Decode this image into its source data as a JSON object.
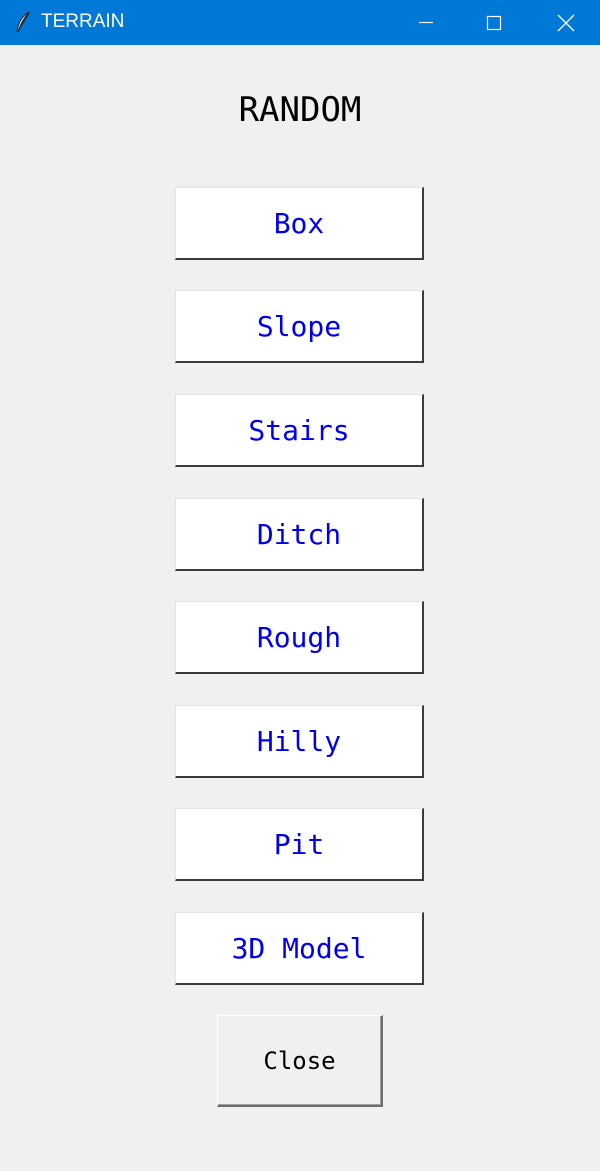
{
  "window": {
    "title": "TERRAIN",
    "app_icon": "feather-icon",
    "controls": {
      "minimize_icon": "minimize-icon",
      "maximize_icon": "maximize-icon",
      "close_icon": "close-icon"
    },
    "titlebar_color": "#0078d7"
  },
  "heading": "RANDOM",
  "terrain_buttons": [
    {
      "label": "Box"
    },
    {
      "label": "Slope"
    },
    {
      "label": "Stairs"
    },
    {
      "label": "Ditch"
    },
    {
      "label": "Rough"
    },
    {
      "label": "Hilly"
    },
    {
      "label": "Pit"
    },
    {
      "label": "3D Model"
    }
  ],
  "close_button": {
    "label": "Close"
  },
  "colors": {
    "button_text": "#0000ee",
    "background": "#f0f0f0"
  }
}
